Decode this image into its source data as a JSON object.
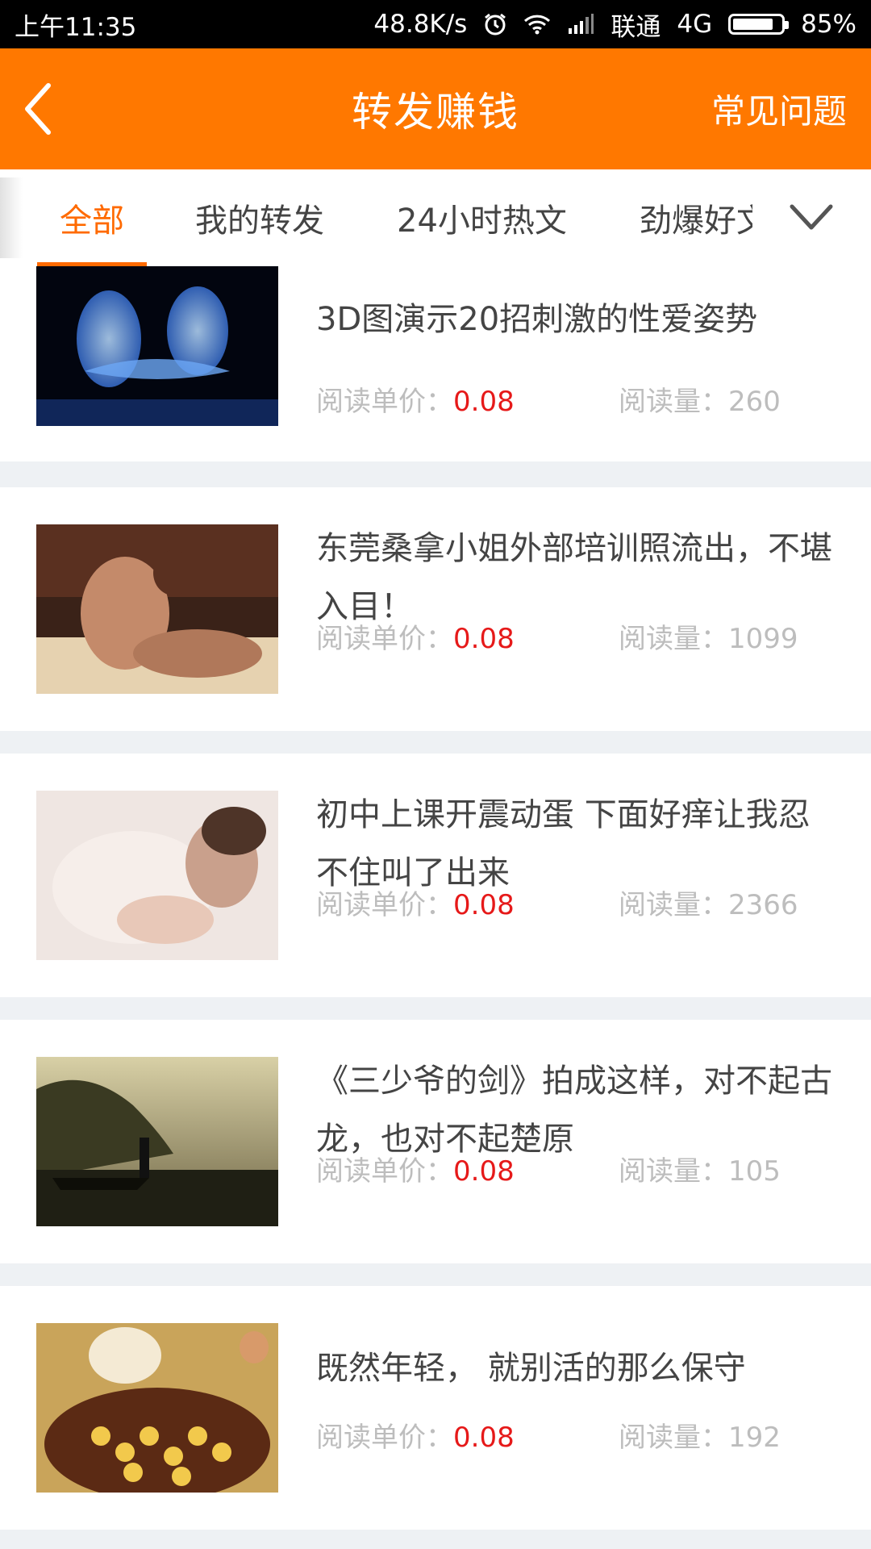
{
  "status_bar": {
    "time": "上午11:35",
    "speed": "48.8K/s",
    "carrier": "联通",
    "network": "4G",
    "battery": "85%",
    "battery_level": 0.85
  },
  "header": {
    "title": "转发赚钱",
    "faq_label": "常见问题"
  },
  "tabs": [
    {
      "label": "全部",
      "active": true
    },
    {
      "label": "我的转发"
    },
    {
      "label": "24小时热文"
    },
    {
      "label": "劲爆好文"
    }
  ],
  "labels": {
    "price_label": "阅读单价：",
    "reads_label": "阅读量："
  },
  "articles": [
    {
      "title": "3D图演示20招刺激的性爱姿势",
      "price": "0.08",
      "reads": "260",
      "thumb": "blue-3d-figures"
    },
    {
      "title": "东莞桑拿小姐外部培训照流出，不堪入目！",
      "price": "0.08",
      "reads": "1099",
      "thumb": "room-photo"
    },
    {
      "title": "初中上课开震动蛋 下面好痒让我忍不住叫了出来",
      "price": "0.08",
      "reads": "2366",
      "thumb": "lace-dress-photo"
    },
    {
      "title": "《三少爷的剑》拍成这样，对不起古龙，也对不起楚原",
      "price": "0.08",
      "reads": "105",
      "thumb": "boat-landscape"
    },
    {
      "title": "既然年轻， 就别活的那么保守",
      "price": "0.08",
      "reads": "192",
      "thumb": "cartoon-illustration"
    }
  ],
  "colors": {
    "accent": "#ff7800",
    "price": "#e61919"
  }
}
